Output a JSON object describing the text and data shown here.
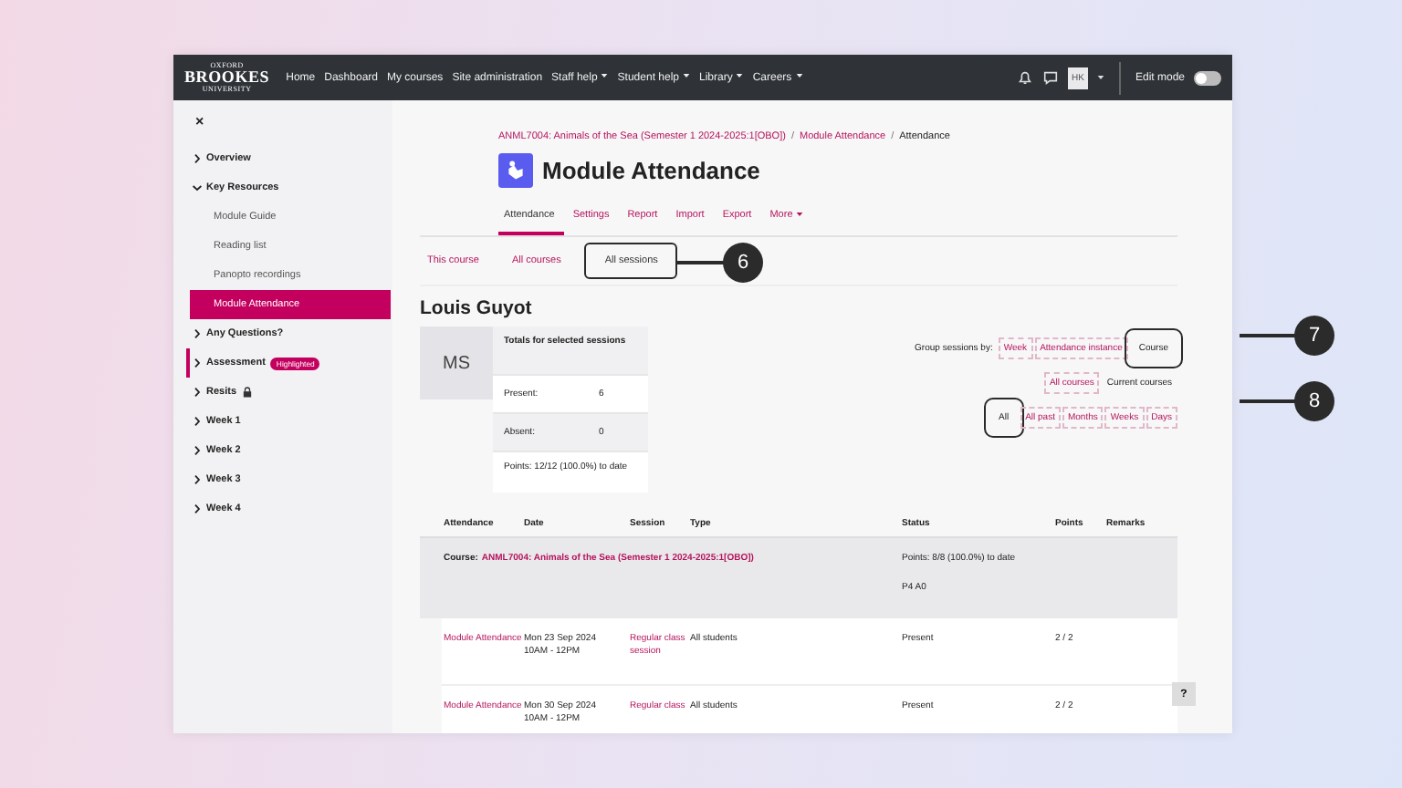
{
  "navbar": {
    "logo": {
      "top": "OXFORD",
      "main": "BROOKES",
      "bottom": "UNIVERSITY"
    },
    "links": [
      {
        "label": "Home",
        "dropdown": false
      },
      {
        "label": "Dashboard",
        "dropdown": false
      },
      {
        "label": "My courses",
        "dropdown": false
      },
      {
        "label": "Site administration",
        "dropdown": false
      },
      {
        "label": "Staff help",
        "dropdown": true
      },
      {
        "label": "Student help",
        "dropdown": true
      },
      {
        "label": "Library",
        "dropdown": true
      },
      {
        "label": "Careers",
        "dropdown": true
      }
    ],
    "avatar": "HK",
    "edit_mode": {
      "label": "Edit mode",
      "on": false
    }
  },
  "sidebar": {
    "close": "×",
    "items": [
      {
        "label": "Overview",
        "kind": "section",
        "expanded": false,
        "selected": false
      },
      {
        "label": "Key Resources",
        "kind": "section",
        "expanded": true,
        "selected": false
      },
      {
        "label": "Module Guide",
        "kind": "link",
        "selected": false
      },
      {
        "label": "Reading list",
        "kind": "link",
        "selected": false
      },
      {
        "label": "Panopto recordings",
        "kind": "link",
        "selected": false
      },
      {
        "label": "Module Attendance",
        "kind": "link",
        "selected": true
      },
      {
        "label": "Any Questions?",
        "kind": "section",
        "expanded": false,
        "selected": false
      },
      {
        "label": "Assessment",
        "kind": "section",
        "expanded": false,
        "selected": false,
        "badge": "Highlighted"
      },
      {
        "label": "Resits",
        "kind": "section",
        "expanded": false,
        "selected": false,
        "locked": true
      },
      {
        "label": "Week 1",
        "kind": "section",
        "expanded": false,
        "selected": false
      },
      {
        "label": "Week 2",
        "kind": "section",
        "expanded": false,
        "selected": false
      },
      {
        "label": "Week 3",
        "kind": "section",
        "expanded": false,
        "selected": false
      },
      {
        "label": "Week 4",
        "kind": "section",
        "expanded": false,
        "selected": false
      }
    ]
  },
  "breadcrumb_separator": "/",
  "breadcrumb": [
    {
      "label": "ANML7004: Animals of the Sea (Semester 1 2024-2025:1[OBO])",
      "link": true
    },
    {
      "label": "Module Attendance",
      "link": true
    },
    {
      "label": "Attendance",
      "link": false
    }
  ],
  "page_title": "Module Attendance",
  "tabs": [
    {
      "label": "Attendance",
      "selected": true,
      "dropdown": false
    },
    {
      "label": "Settings",
      "selected": false,
      "dropdown": false
    },
    {
      "label": "Report",
      "selected": false,
      "dropdown": false
    },
    {
      "label": "Import",
      "selected": false,
      "dropdown": false
    },
    {
      "label": "Export",
      "selected": false,
      "dropdown": false
    },
    {
      "label": "More",
      "selected": false,
      "dropdown": true
    }
  ],
  "subtabs": [
    {
      "label": "This course",
      "selected": false,
      "framed": false
    },
    {
      "label": "All courses",
      "selected": false,
      "framed": false
    },
    {
      "label": "All sessions",
      "selected": true,
      "framed": true
    }
  ],
  "student": {
    "name": "Louis Guyot",
    "initials": "MS"
  },
  "totals": {
    "heading": "Totals for selected sessions",
    "rows": [
      {
        "label": "Present:",
        "value": "6"
      },
      {
        "label": "Absent:",
        "value": "0"
      }
    ],
    "points": "Points: 12/12 (100.0%) to date"
  },
  "group_by": {
    "label": "Group sessions by:",
    "options": [
      {
        "label": "Week",
        "selected": false,
        "framed": false
      },
      {
        "label": "Attendance instance",
        "selected": false,
        "framed": false
      },
      {
        "label": "Course",
        "selected": true,
        "framed": true
      }
    ]
  },
  "course_filter": [
    {
      "label": "All courses",
      "selected": false
    },
    {
      "label": "Current courses",
      "selected": true
    }
  ],
  "period_filter": [
    {
      "label": "All",
      "selected": true,
      "framed": true
    },
    {
      "label": "All past",
      "selected": false,
      "framed": false
    },
    {
      "label": "Months",
      "selected": false,
      "framed": false
    },
    {
      "label": "Weeks",
      "selected": false,
      "framed": false
    },
    {
      "label": "Days",
      "selected": false,
      "framed": false
    }
  ],
  "table": {
    "columns": [
      "Attendance",
      "Date",
      "Session",
      "Type",
      "Status",
      "Points",
      "Remarks"
    ],
    "group": {
      "label": "Course:",
      "course": "ANML7004: Animals of the Sea (Semester 1 2024-2025:1[OBO])",
      "points": "Points: 8/8 (100.0%) to date",
      "summary": "P4 A0"
    },
    "rows": [
      {
        "attendance": "Module Attendance",
        "date": "Mon 23 Sep 2024",
        "time": "10AM - 12PM",
        "session": "Regular class session",
        "type": "All students",
        "status": "Present",
        "points": "2 / 2"
      },
      {
        "attendance": "Module Attendance",
        "date": "Mon 30 Sep 2024",
        "time": "10AM - 12PM",
        "session": "Regular class",
        "type": "All students",
        "status": "Present",
        "points": "2 / 2"
      }
    ]
  },
  "help_button": "?",
  "callouts": [
    {
      "number": "6"
    },
    {
      "number": "7"
    },
    {
      "number": "8"
    }
  ]
}
